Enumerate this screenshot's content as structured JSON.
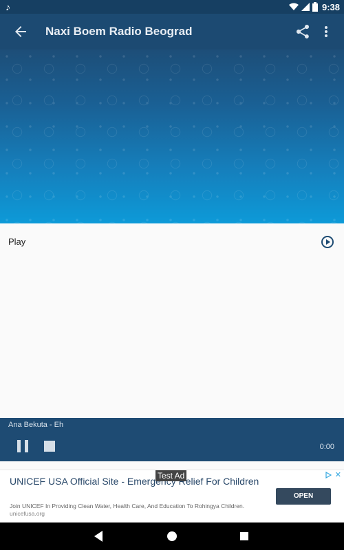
{
  "status_bar": {
    "time": "9:38",
    "icons": [
      "music-note-icon",
      "wifi-icon",
      "signal-icon",
      "battery-icon"
    ]
  },
  "toolbar": {
    "title": "Naxi Boem Radio Beograd"
  },
  "play_row": {
    "label": "Play"
  },
  "player": {
    "track": "Ana Bekuta - Eh",
    "elapsed": "0:00"
  },
  "ad": {
    "badge": "Test Ad",
    "headline": "UNICEF USA Official Site - Emergency Relief For Children",
    "body": "Join UNICEF In Providing Clean Water, Health Care, And Education To Rohingya Children.",
    "domain": "unicefusa.org",
    "cta": "OPEN"
  },
  "colors": {
    "toolbar": "#1c4a72",
    "player": "#1e4b73",
    "accent": "#0d9ad8"
  }
}
